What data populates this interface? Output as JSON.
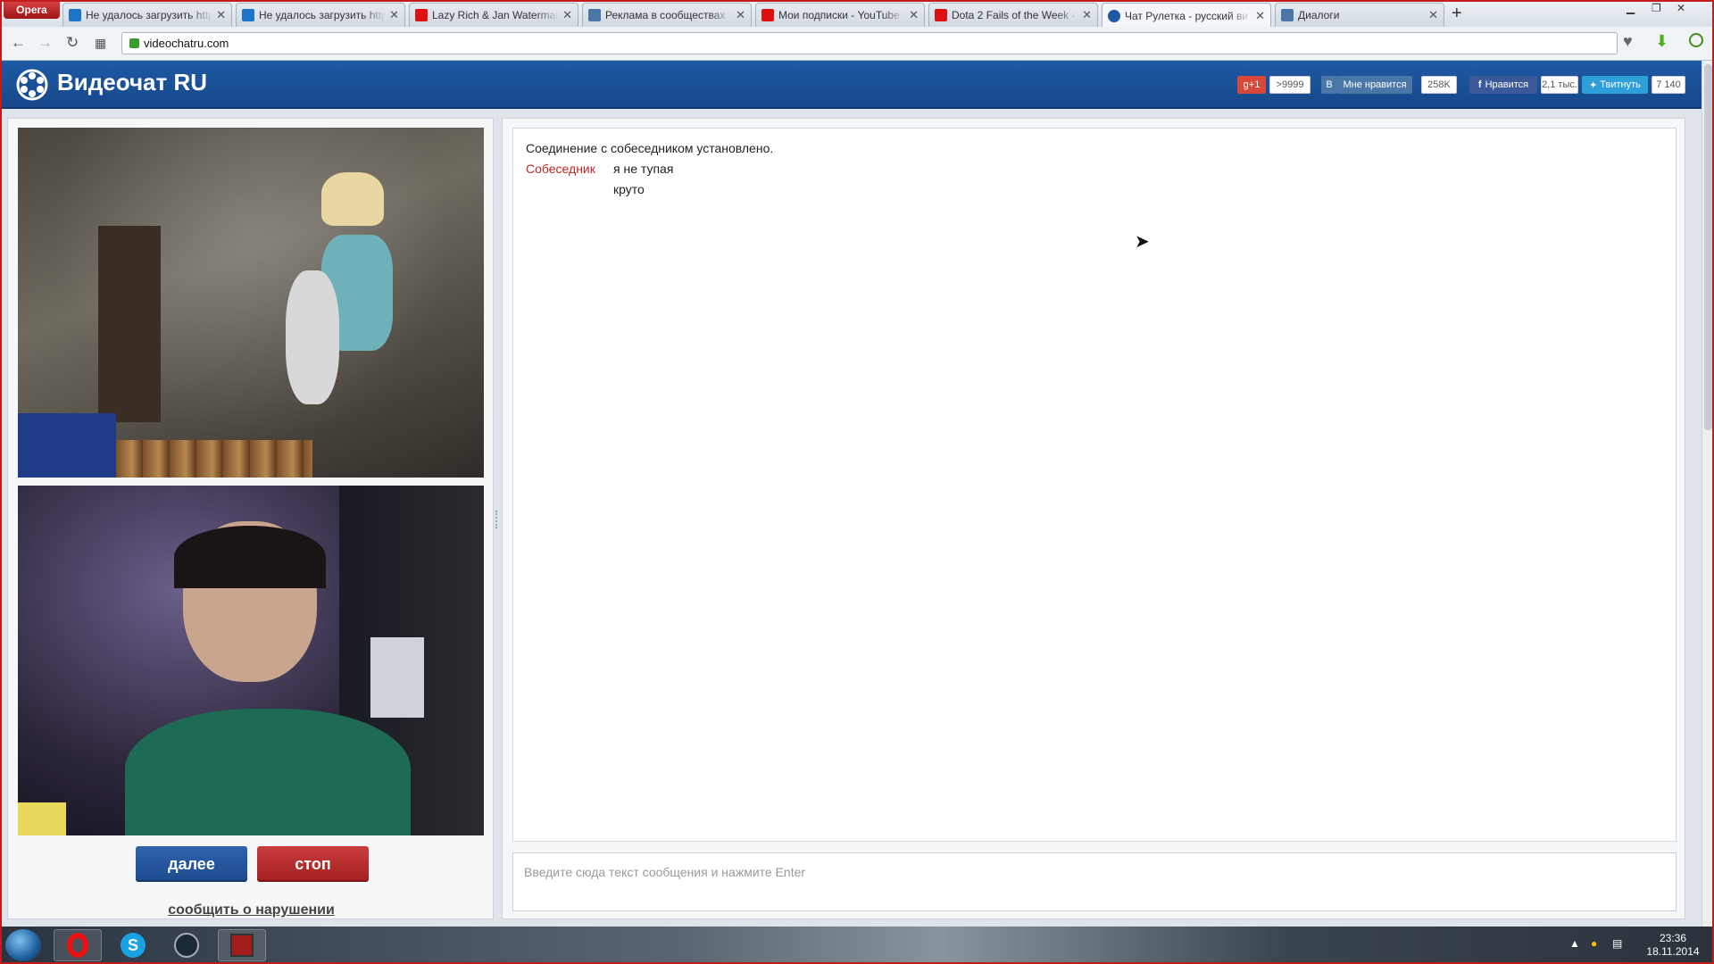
{
  "browser": {
    "menu_label": "Opera",
    "tabs": [
      {
        "label": "Не удалось загрузить http",
        "icon": "upload-arrow-icon",
        "active": false
      },
      {
        "label": "Не удалось загрузить http",
        "icon": "upload-arrow-icon",
        "active": false
      },
      {
        "label": "Lazy Rich & Jan Waterman",
        "icon": "youtube-icon",
        "active": false
      },
      {
        "label": "Реклама в сообществах",
        "icon": "vk-icon",
        "active": false
      },
      {
        "label": "Мои подписки - YouTube",
        "icon": "youtube-icon",
        "active": false
      },
      {
        "label": "Dota 2 Fails of the Week -",
        "icon": "youtube-icon",
        "active": false
      },
      {
        "label": "Чат Рулетка - русский ви",
        "icon": "videochat-icon",
        "active": true
      },
      {
        "label": "Диалоги",
        "icon": "vk-dialogs-icon",
        "active": false
      }
    ],
    "url": "videochatru.com"
  },
  "site": {
    "logo_text": "Видеочат RU",
    "social": {
      "gplus_label": "g+1",
      "gplus_count": ">9999",
      "vk_label": "В",
      "vk_like_label": "Мне нравится",
      "vk_count": "258K",
      "fb_label": "Нравится",
      "fb_count": "2,1 тыс.",
      "tw_label": "Твитнуть",
      "tw_count": "7 140"
    },
    "buttons": {
      "next_label": "далее",
      "stop_label": "стоп"
    },
    "report_label": "сообщить о нарушении",
    "chat": {
      "system_message": "Соединение с собеседником установлено.",
      "messages": [
        {
          "author": "Собеседник",
          "text": "я не тупая"
        },
        {
          "author": "",
          "text": "круто"
        }
      ],
      "input_placeholder": "Введите сюда текст сообщения и нажмите Enter"
    }
  },
  "taskbar": {
    "time": "23:36",
    "date": "18.11.2014",
    "apps": [
      "opera-icon",
      "skype-icon",
      "steam-icon",
      "dota2-icon"
    ]
  }
}
